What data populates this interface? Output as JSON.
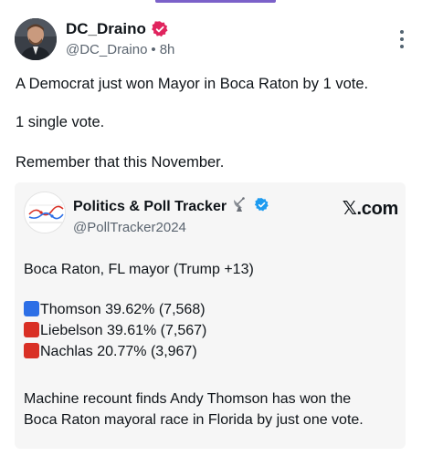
{
  "post": {
    "author_name": "DC_Draino",
    "handle": "@DC_Draino",
    "separator": "•",
    "time": "8h",
    "verified_color": "#e0245e",
    "lines": [
      "A Democrat just won Mayor in Boca Raton by 1 vote.",
      "1 single vote.",
      "Remember that this November."
    ]
  },
  "quoted": {
    "author_name": "Politics & Poll Tracker",
    "handle": "@PollTracker2024",
    "source": "𝕏.com",
    "verified_color": "#1d9bf0",
    "lines": [
      "Boca Raton, FL mayor (Trump +13)",
      "Thomson 39.62% (7,568)",
      "Liebelson 39.61% (7,567)",
      "Nachlas 20.77% (3,967)",
      "Machine recount finds Andy Thomson has won the",
      "Boca Raton mayoral race in Florida by just one vote."
    ],
    "candidate_colors": [
      "#2d6fe6",
      "#d93025",
      "#d93025"
    ]
  },
  "icons": {
    "menu": "more-vertical-icon",
    "verified": "verified-badge-icon",
    "satellite": "satellite-dish-icon"
  }
}
